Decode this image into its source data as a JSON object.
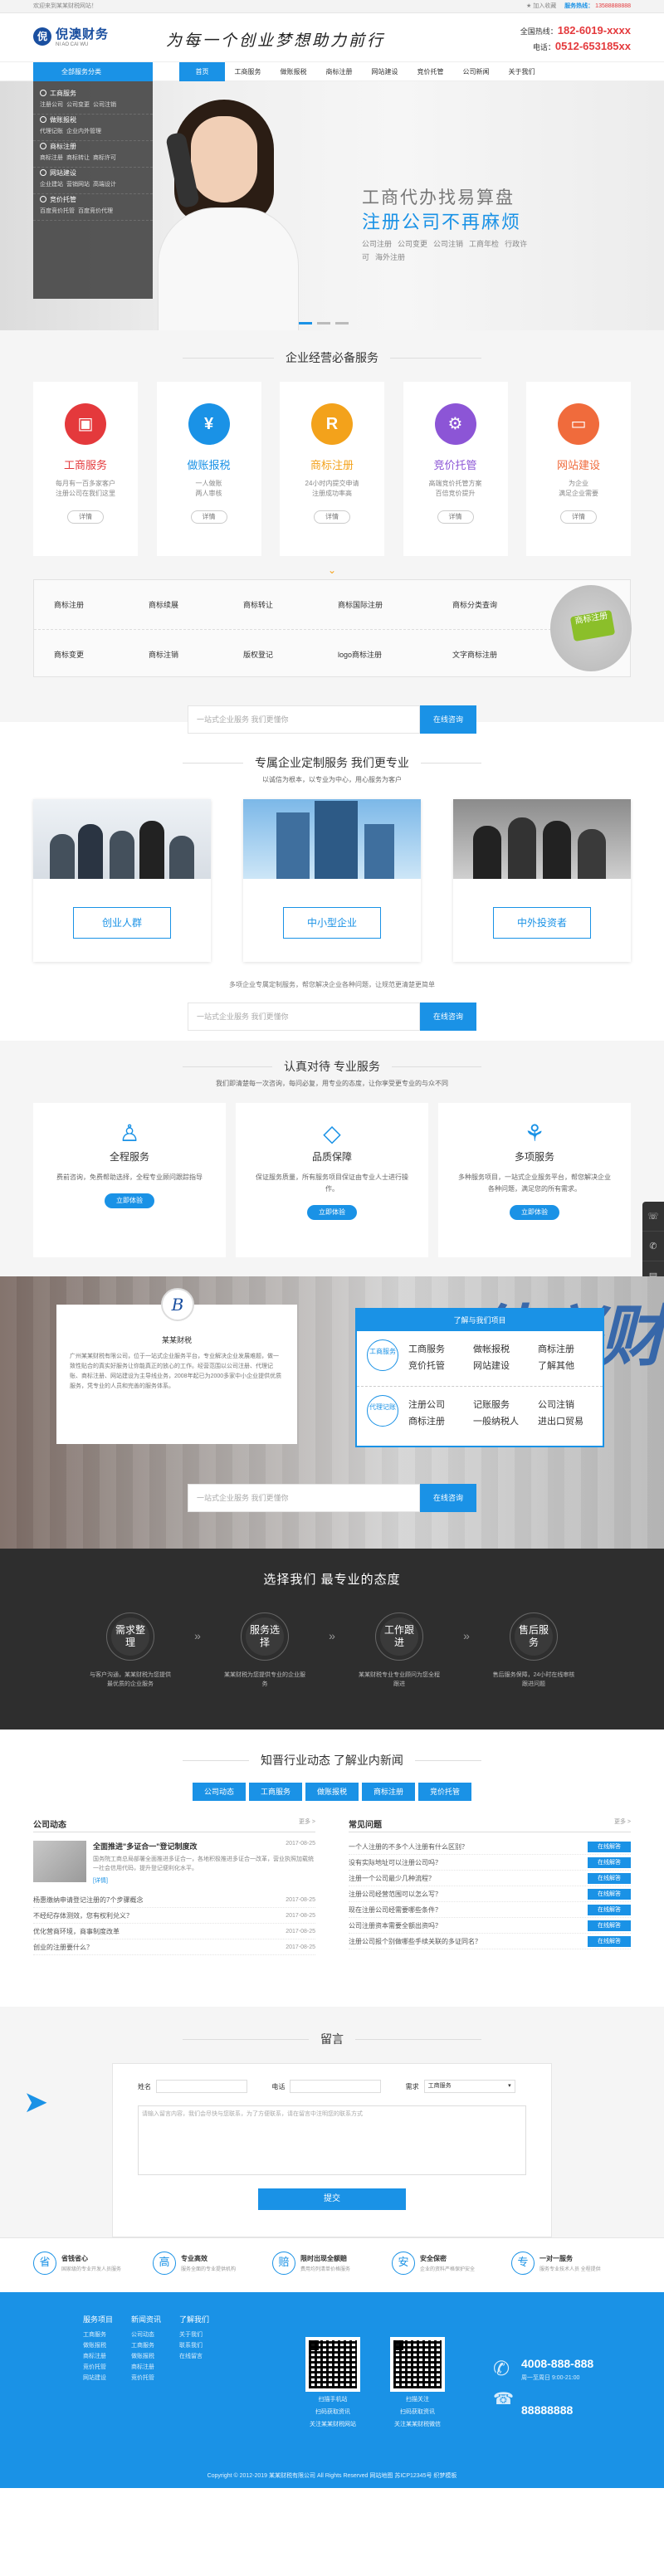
{
  "topbar": {
    "left": "欢迎来到某某财税网站！",
    "fav": "加入收藏",
    "phone_label": "服务热线：",
    "phone": "13588888888"
  },
  "header": {
    "logo_mark": "倪",
    "logo_title": "倪澳财务",
    "logo_sub": "NI AO CAI WU",
    "slogan": "为每一个创业梦想助力前行",
    "hotline_label1": "全国热线：",
    "hotline1": "182-6019-xxxx",
    "hotline_label2": "电话：",
    "hotline2": "0512-653185xx"
  },
  "nav": {
    "cat": "全部服务分类",
    "items": [
      "首页",
      "工商服务",
      "做账报税",
      "商标注册",
      "网站建设",
      "竞价托管",
      "公司新闻",
      "关于我们"
    ]
  },
  "catmenu": [
    {
      "h": "工商服务",
      "s": [
        "注册公司",
        "公司变更",
        "公司注销"
      ]
    },
    {
      "h": "做账报税",
      "s": [
        "代理记账",
        "企业内外管理"
      ]
    },
    {
      "h": "商标注册",
      "s": [
        "商标注册",
        "商标转让",
        "商标许可"
      ]
    },
    {
      "h": "网站建设",
      "s": [
        "企业建站",
        "营销网站",
        "高端设计"
      ]
    },
    {
      "h": "竞价托管",
      "s": [
        "百度竞价托管",
        "百度竞价代理"
      ]
    }
  ],
  "banner": {
    "cap1": "工商代办找易算盘",
    "cap2": "注册公司不再麻烦",
    "tags": [
      "公司注册",
      "公司变更",
      "公司注销",
      "工商年检",
      "行政许可",
      "海外注册"
    ]
  },
  "sec1": {
    "title": "企业经营必备服务",
    "services": [
      {
        "name": "工商服务",
        "icon": "briefcase-icon",
        "glyph": "▣",
        "desc1": "每月有一百多家客户",
        "desc2": "注册公司在我们这里",
        "btn": "详情",
        "color": "#e4393c"
      },
      {
        "name": "做账报税",
        "icon": "yen-icon",
        "glyph": "¥",
        "desc1": "一人做账",
        "desc2": "两人审核",
        "btn": "详情",
        "color": "#1a92e6"
      },
      {
        "name": "商标注册",
        "icon": "registered-icon",
        "glyph": "R",
        "desc1": "24小时内提交申请",
        "desc2": "注册成功率高",
        "btn": "详情",
        "color": "#f3a21b"
      },
      {
        "name": "竞价托管",
        "icon": "gear-icon",
        "glyph": "⚙",
        "desc1": "高端竞价托管方案",
        "desc2": "百倍竞价提升",
        "btn": "详情",
        "color": "#8c55d6"
      },
      {
        "name": "网站建设",
        "icon": "monitor-icon",
        "glyph": "▭",
        "desc1": "为企业",
        "desc2": "满足企业需要",
        "btn": "详情",
        "color": "#f06b3c"
      }
    ],
    "tags_row1": [
      "商标注册",
      "商标续展",
      "商标转让",
      "商标国际注册",
      "商标分类查询"
    ],
    "tags_row2": [
      "商标变更",
      "商标注销",
      "版权登记",
      "logo商标注册",
      "文字商标注册"
    ],
    "badge": "商标注册",
    "search_placeholder": "一站式企业服务 我们更懂你",
    "search_btn": "在线咨询"
  },
  "sec2": {
    "title": "专属企业定制服务  我们更专业",
    "sub": "以诚信为根本，以专业为中心，用心服务为客户",
    "cards": [
      "创业人群",
      "中小型企业",
      "中外投资者"
    ],
    "note": "多项企业专属定制服务，帮您解决企业各种问题，让规范更清楚更简单",
    "search_placeholder": "一站式企业服务 我们更懂你",
    "search_btn": "在线咨询"
  },
  "sec3": {
    "title": "认真对待 专业服务",
    "sub": "我们即清楚每一次咨询，每问必复，用专业的态度，让你享受更专业的与众不同",
    "feats": [
      {
        "name": "全程服务",
        "icon": "person-icon",
        "glyph": "♙",
        "desc": "费前咨询，免费帮助选择，全程专业顾问跟踪指导",
        "btn": "立即体验"
      },
      {
        "name": "品质保障",
        "icon": "diamond-icon",
        "glyph": "◇",
        "desc": "保证服务质量，所有服务项目保证由专业人士进行操作。",
        "btn": "立即体验"
      },
      {
        "name": "多项服务",
        "icon": "grid-icon",
        "glyph": "⚘",
        "desc": "多种服务项目，一站式企业服务平台，帮您解决企业各种问题，满足您的所有需求。",
        "btn": "立即体验"
      }
    ],
    "sidebar": [
      "☏",
      "✆",
      "▤",
      "☎",
      "◎",
      "✎"
    ]
  },
  "sec4": {
    "about_mark": "B",
    "about_title": "某某财税",
    "about_text": "广州某某财税有限公司，位于一站式企业服务平台，专业解决企业发展难题，做一致性贴合的真实好服务让你能真正的放心的工作。经营范围以公司注册、代理记账、商标注册、网站建设为主导线业务，2008年起已为2000多家中小企业提供优质服务，凭专业的人员和完善的服务体系。",
    "side_title": "了解与我们项目",
    "group1_label": "工商服务",
    "group1": [
      "工商服务",
      "做帐报税",
      "商标注册",
      "竞价托管",
      "网站建设",
      "了解其他"
    ],
    "group2_label": "代理记账",
    "group2": [
      "注册公司",
      "记账服务",
      "公司注销",
      "商标注册",
      "一般纳税人",
      "进出口贸易"
    ],
    "big_letters": "佳兴财",
    "search_placeholder": "一站式企业服务 我们更懂你",
    "search_btn": "在线咨询"
  },
  "sec5": {
    "title": "选择我们  最专业的态度",
    "steps": [
      {
        "c": "需求整理",
        "d": "与客户沟通，某某财税为您提供最优质的企业服务"
      },
      {
        "c": "服务选择",
        "d": "某某财税为您提供专业的企业服务"
      },
      {
        "c": "工作跟进",
        "d": "某某财税专业专业顾问为您全程跟进"
      },
      {
        "c": "售后服务",
        "d": "售后服务保障，24小时在线审核跟进问题"
      }
    ],
    "sep": "»"
  },
  "sec6": {
    "title": "知晋行业动态  了解业内新闻",
    "tabs": [
      "公司动态",
      "工商服务",
      "做账报税",
      "商标注册",
      "竞价托管"
    ],
    "left_head": "公司动态",
    "more": "更多 >",
    "feat_title": "全面推进\"多证合一\"登记制度改",
    "feat_date": "2017-08-25",
    "feat_text": "国务院工商总局部署全面推进多证合一，各地积极推进多证合一改革，营业执照加载统一社会信用代码，提升登记便利化水平。",
    "feat_more": "[详情]",
    "left_list": [
      {
        "t": "杨惠缴纳申请登记注册的7个步骤概念",
        "d": "2017-08-25"
      },
      {
        "t": "不经纪存体测效，您有权利兑义？",
        "d": "2017-08-25"
      },
      {
        "t": "优化营商环境，商事制度改革",
        "d": "2017-08-25"
      },
      {
        "t": "创业的注册要什么？",
        "d": "2017-08-25"
      }
    ],
    "right_head": "常见问题",
    "right_list": [
      "一个人注册的不多个人注册有什么区别？",
      "没有实际地址可以注册公司吗？",
      "注册一个公司最少几种流程？",
      "注册公司经营范围可以怎么写？",
      "现在注册公司经需要哪些条件？",
      "公司注册资本需要全额出资吗？",
      "注册公司报个别做哪些手续关联的多证同名？"
    ],
    "ask_label": "在线解答"
  },
  "sec7": {
    "title": "留言",
    "name_label": "姓名",
    "phone_label": "电话",
    "type_label": "需求",
    "type_value": "工商服务",
    "msg_placeholder": "请输入留言内容，我们会尽快与您联系，为了方便联系，请在留言中注明您的联系方式",
    "submit": "提交"
  },
  "promos": [
    {
      "badge": "省",
      "title": "省钱省心",
      "sub": "国家级的专业开发人员服务"
    },
    {
      "badge": "高",
      "title": "专业高效",
      "sub": "服务全面的专业提供机构"
    },
    {
      "badge": "赔",
      "title": "限时出现全额赔",
      "sub": "费用均列清单价格服务"
    },
    {
      "badge": "安",
      "title": "安全保密",
      "sub": "企业的资料严格保护安全"
    },
    {
      "badge": "专",
      "title": "一对一服务",
      "sub": "服务专业技术人员 全程提供"
    }
  ],
  "footer": {
    "cols": [
      {
        "h": "服务项目",
        "items": [
          "工商服务",
          "做账报税",
          "商标注册",
          "竞价托管",
          "网站建设"
        ]
      },
      {
        "h": "新闻资讯",
        "items": [
          "公司动态",
          "工商服务",
          "做账报税",
          "商标注册",
          "竞价托管"
        ]
      },
      {
        "h": "了解我们",
        "items": [
          "关于我们",
          "联系我们",
          "在线留言"
        ]
      }
    ],
    "qr1": [
      "扫描手机站",
      "扫码获取资讯",
      "关注某某财税网站"
    ],
    "qr2": [
      "扫描关注",
      "扫码获取资讯",
      "关注某某财税微信"
    ],
    "tel1": "4008-888-888",
    "tel1_sub": "周一至周日 9:00-21:00",
    "tel2": "88888888",
    "copy": "Copyright © 2012-2019 某某财税有限公司 All Rights Reserved  网站地图  苏ICP12345号  织梦模板"
  }
}
